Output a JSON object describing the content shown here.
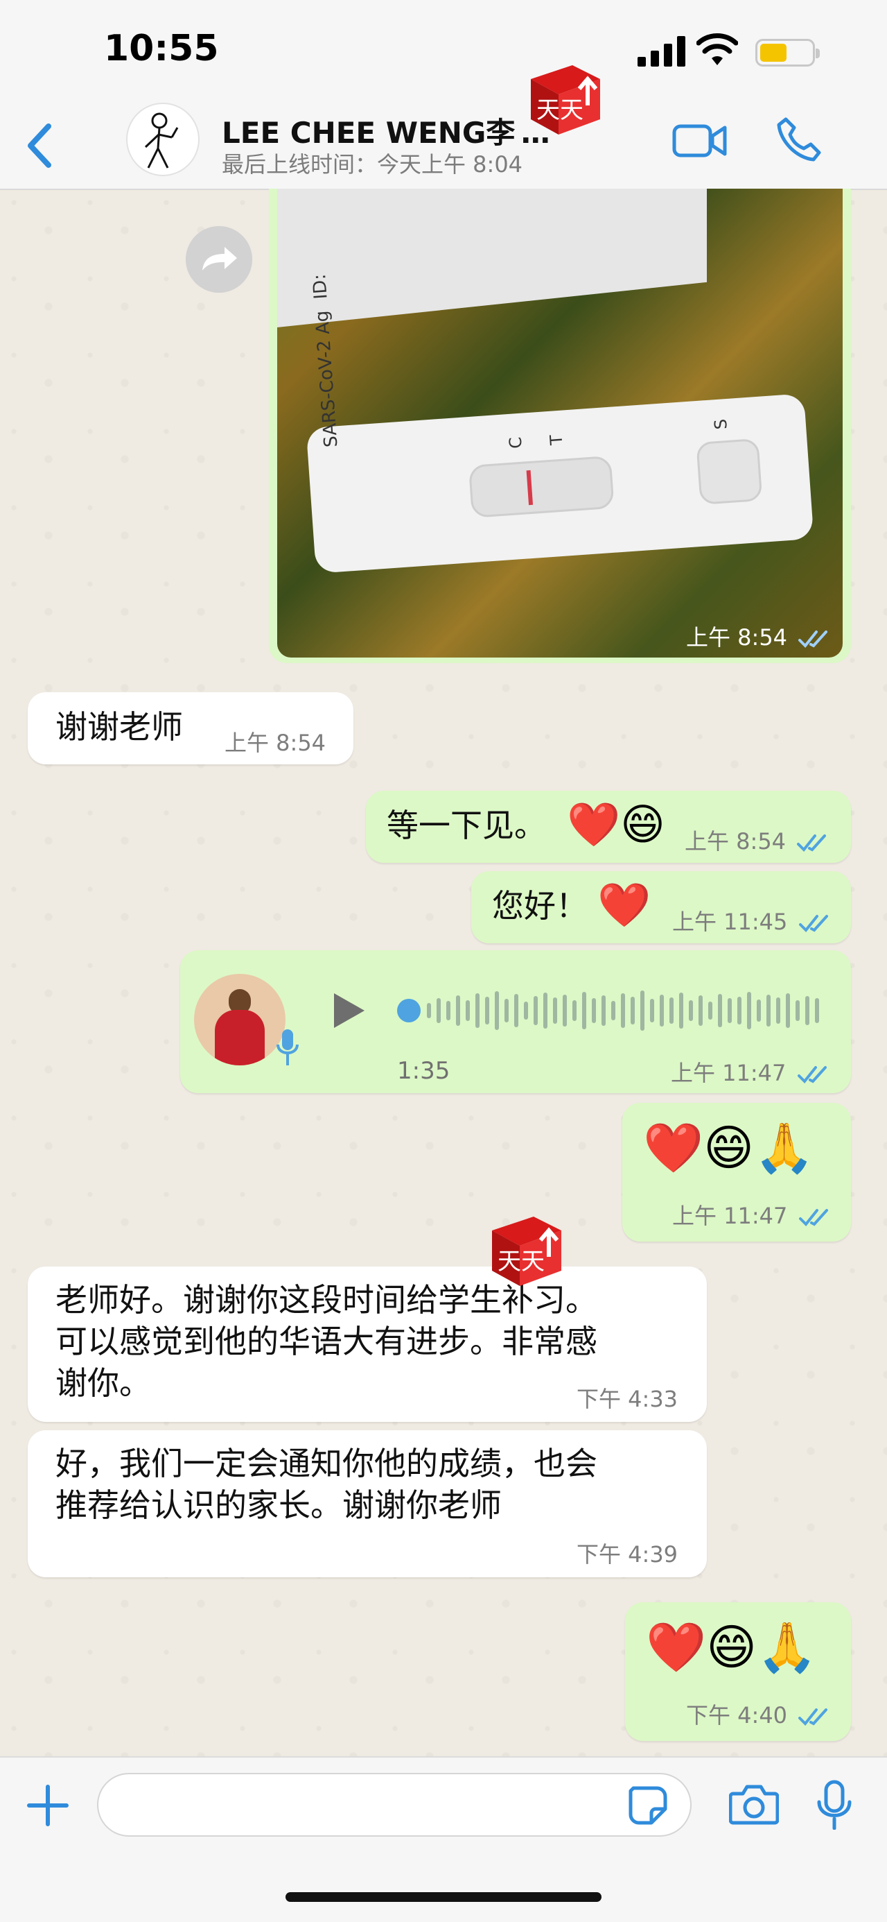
{
  "status_bar": {
    "time": "10:55"
  },
  "header": {
    "contact_name": "LEE CHEE WENG李 …",
    "last_seen": "最后上线时间：今天上午 8:04"
  },
  "messages": [
    {
      "type": "image",
      "direction": "out",
      "time": "上午 8:54",
      "kit_label": "SARS-CoV-2 Ag",
      "kit_id": "ID:",
      "kit_c": "C",
      "kit_t": "T",
      "kit_s": "S"
    },
    {
      "type": "text",
      "direction": "in",
      "text": "谢谢老师",
      "time": "上午 8:54"
    },
    {
      "type": "text",
      "direction": "out",
      "text": "等一下见。",
      "emoji": "❤️😄",
      "time": "上午 8:54"
    },
    {
      "type": "text",
      "direction": "out",
      "text": "您好！",
      "emoji": "❤️",
      "time": "上午 11:45"
    },
    {
      "type": "voice",
      "direction": "out",
      "duration": "1:35",
      "time": "上午 11:47"
    },
    {
      "type": "emoji",
      "direction": "out",
      "emoji": "❤️😄🙏",
      "time": "上午 11:47"
    },
    {
      "type": "text",
      "direction": "in",
      "lines": [
        "老师好。谢谢你这段时间给学生补习。",
        "可以感觉到他的华语大有进步。非常感",
        "谢你。"
      ],
      "time": "下午 4:33"
    },
    {
      "type": "text",
      "direction": "in",
      "lines": [
        "好，我们一定会通知你他的成绩，也会",
        "推荐给认识的家长。谢谢你老师"
      ],
      "time": "下午 4:39"
    },
    {
      "type": "emoji",
      "direction": "out",
      "emoji": "❤️😄🙏",
      "time": "下午 4:40"
    }
  ],
  "watermark": {
    "text": "天天"
  },
  "colors": {
    "accent": "#2f8bdb",
    "out_bubble": "#dcf8c6",
    "in_bubble": "#ffffff",
    "read_ticks": "#4fa3e0"
  },
  "icons": [
    "back-chevron-icon",
    "video-call-icon",
    "phone-call-icon",
    "forward-icon",
    "play-icon",
    "mic-icon",
    "plus-icon",
    "sticker-icon",
    "camera-icon"
  ]
}
